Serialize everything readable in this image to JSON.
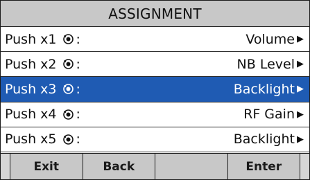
{
  "screen": {
    "title": "ASSIGNMENT"
  },
  "menu": {
    "items": [
      {
        "label": "Push x1",
        "separator": ":",
        "value": "Volume",
        "selected": false
      },
      {
        "label": "Push x2",
        "separator": ":",
        "value": "NB Level",
        "selected": false
      },
      {
        "label": "Push x3",
        "separator": ":",
        "value": "Backlight",
        "selected": true
      },
      {
        "label": "Push x4",
        "separator": ":",
        "value": "RF Gain",
        "selected": false
      },
      {
        "label": "Push x5",
        "separator": ":",
        "value": "Backlight",
        "selected": false
      }
    ],
    "row_icon": "dial-knob-icon",
    "value_icon": "triangle-right-icon"
  },
  "softkeys": [
    {
      "label": "Exit"
    },
    {
      "label": "Back"
    },
    {
      "label": ""
    },
    {
      "label": "Enter"
    }
  ],
  "colors": {
    "selection": "#1f5bb3",
    "title_bar": "#c8c8c8",
    "softkey_bar": "#c8c8c8"
  }
}
